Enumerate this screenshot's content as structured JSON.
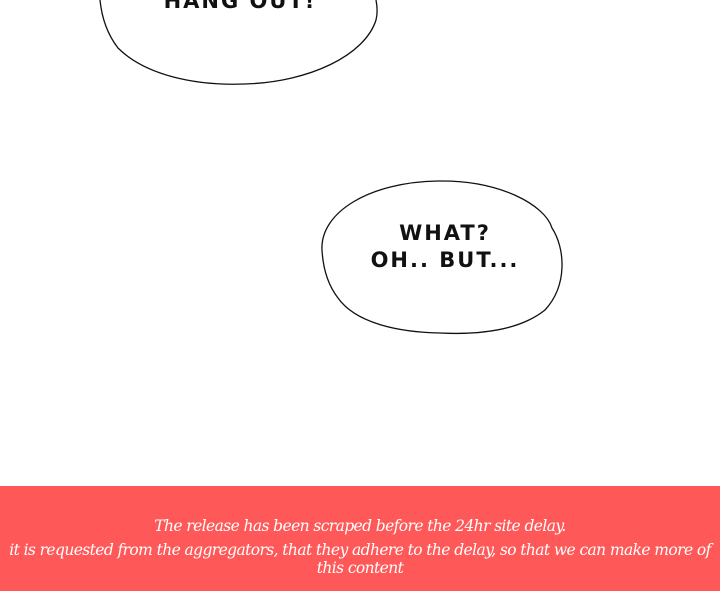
{
  "bubbles": [
    {
      "text": "HANG OUT!"
    },
    {
      "line1": "WHAT?",
      "line2": "OH.. BUT..."
    }
  ],
  "banner": {
    "color": "#FF5858",
    "line1": "The release has been scraped before the 24hr site delay.",
    "line2": "it is requested from the aggregators, that they adhere to the delay, so that we can make more of this content"
  }
}
